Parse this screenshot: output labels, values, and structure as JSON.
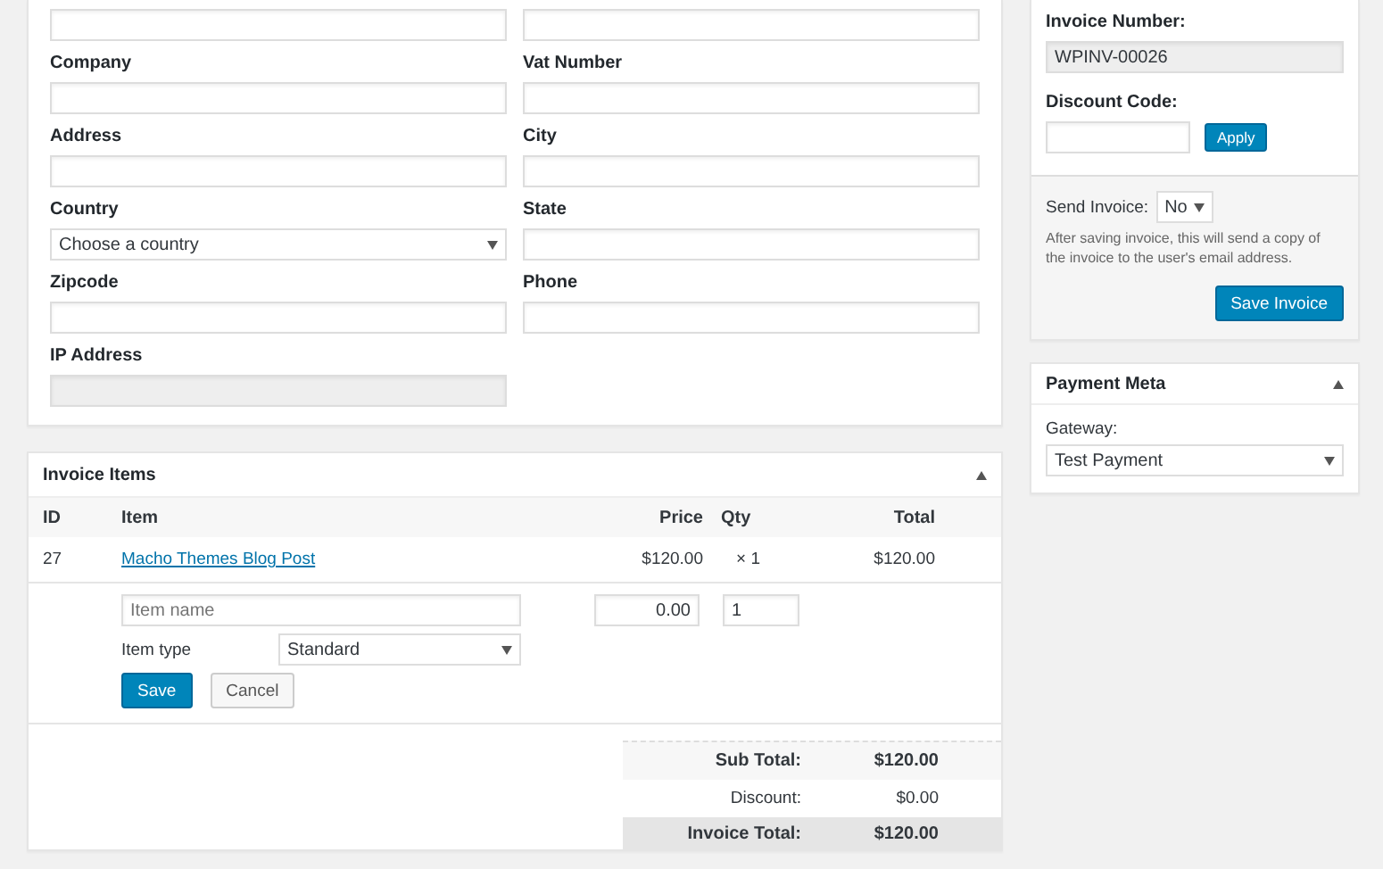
{
  "customer_form": {
    "fields": [
      {
        "kind": "text"
      },
      {
        "kind": "text"
      },
      {
        "label": "Company",
        "kind": "text"
      },
      {
        "label": "Vat Number",
        "kind": "text"
      },
      {
        "label": "Address",
        "kind": "text"
      },
      {
        "label": "City",
        "kind": "text"
      },
      {
        "label": "Country",
        "kind": "select",
        "value": "Choose a country"
      },
      {
        "label": "State",
        "kind": "text"
      },
      {
        "label": "Zipcode",
        "kind": "text"
      },
      {
        "label": "Phone",
        "kind": "text"
      },
      {
        "label": "IP Address",
        "kind": "readonly"
      }
    ]
  },
  "invoice_items": {
    "title": "Invoice Items",
    "expanded": true,
    "columns": [
      "ID",
      "Item",
      "Price",
      "Qty",
      "Total"
    ],
    "rows": [
      {
        "id": "27",
        "item": "Macho Themes Blog Post",
        "price": "$120.00",
        "qty": "× 1",
        "total": "$120.00"
      }
    ],
    "new_item": {
      "name_placeholder": "Item name",
      "price": "0.00",
      "qty": "1",
      "type_label": "Item type",
      "type_value": "Standard",
      "save": "Save",
      "cancel": "Cancel"
    },
    "totals": [
      {
        "kind": "sub",
        "label": "Sub Total:",
        "value": "$120.00"
      },
      {
        "kind": "plain",
        "label": "Discount:",
        "value": "$0.00"
      },
      {
        "kind": "grand",
        "label": "Invoice Total:",
        "value": "$120.00"
      }
    ]
  },
  "invoice_details": {
    "number_label": "Invoice Number:",
    "number": "WPINV-00026",
    "discount_label": "Discount Code:",
    "apply": "Apply",
    "send_label": "Send Invoice:",
    "send_value": "No",
    "send_help": "After saving invoice, this will send a copy of the invoice to the user's email address.",
    "save": "Save Invoice"
  },
  "payment_meta": {
    "title": "Payment Meta",
    "expanded": true,
    "gateway_label": "Gateway:",
    "gateway": "Test Payment"
  }
}
